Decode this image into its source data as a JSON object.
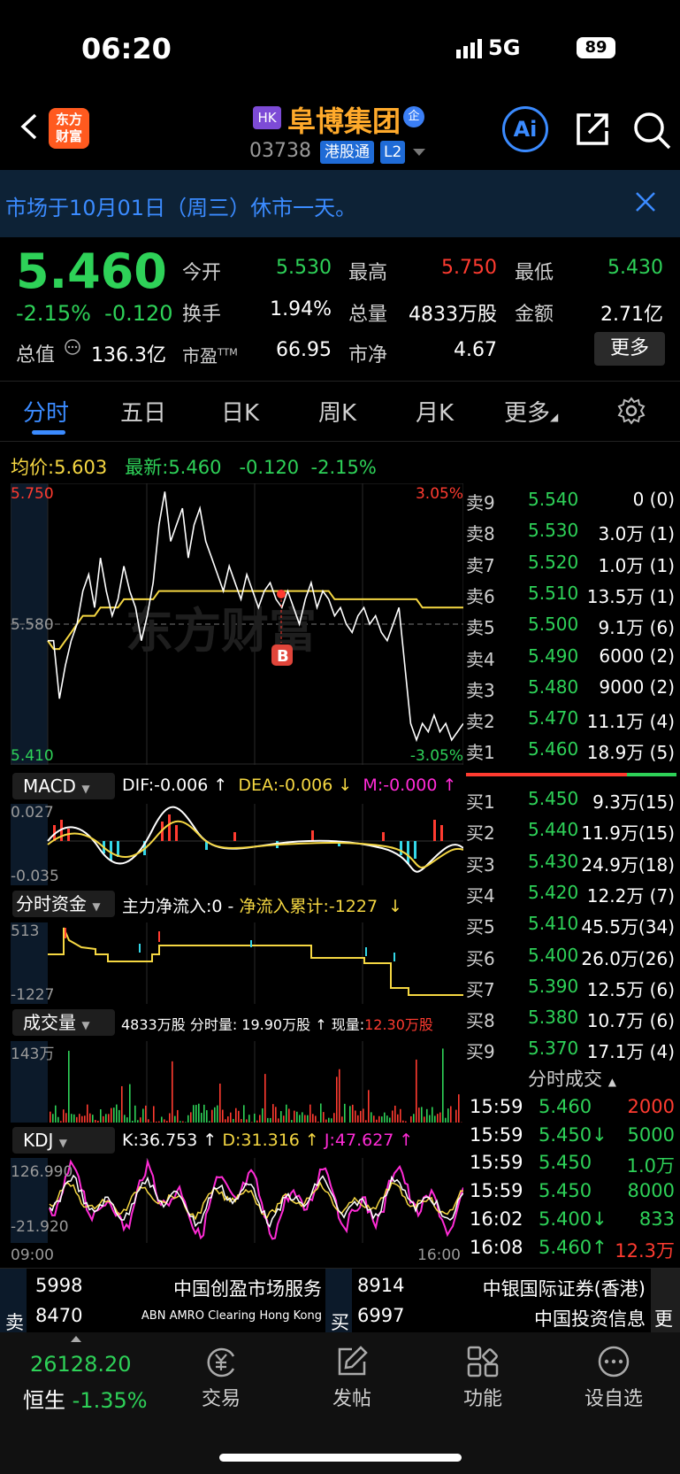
{
  "status": {
    "time": "06:20",
    "network": "5G",
    "battery": "89"
  },
  "header": {
    "market_badge": "HK",
    "name": "阜博集团",
    "qy_badge": "企",
    "code": "03738",
    "ggt": "港股通",
    "level": "L2",
    "logo": "东方\n财富",
    "ai": "Ai"
  },
  "notice": {
    "text": "市场于10月01日（周三）休市一天。"
  },
  "quote": {
    "price": "5.460",
    "change_pct": "-2.15%",
    "change": "-0.120",
    "open_label": "今开",
    "open": "5.530",
    "high_label": "最高",
    "high": "5.750",
    "low_label": "最低",
    "low": "5.430",
    "turnover_label": "换手",
    "turnover": "1.94%",
    "volume_label": "总量",
    "volume": "4833万股",
    "amount_label": "金额",
    "amount": "2.71亿",
    "mktcap_label": "总值",
    "mktcap": "136.3亿",
    "pe_label": "市盈",
    "pe_sup": "TTM",
    "pe": "66.95",
    "pb_label": "市净",
    "pb": "4.67",
    "more": "更多"
  },
  "tabs": [
    "分时",
    "五日",
    "日K",
    "周K",
    "月K",
    "更多"
  ],
  "infoline": {
    "avg_label": "均价:",
    "avg": "5.603",
    "last_label": "最新:",
    "last": "5.460",
    "chg": "-0.120",
    "pct": "-2.15%"
  },
  "chart_data": {
    "type": "line",
    "title": "",
    "price_axis": {
      "top": "5.750",
      "mid": "5.580",
      "bottom": "5.410",
      "top_pct": "3.05%",
      "bottom_pct": "-3.05%"
    },
    "time_axis": {
      "start": "09:00",
      "end": "16:00"
    },
    "marker": "B",
    "watermark": "东方财富",
    "ylim": [
      5.41,
      5.75
    ],
    "price": [
      5.56,
      5.56,
      5.49,
      5.53,
      5.56,
      5.58,
      5.62,
      5.64,
      5.6,
      5.66,
      5.62,
      5.59,
      5.61,
      5.65,
      5.62,
      5.6,
      5.56,
      5.59,
      5.63,
      5.7,
      5.74,
      5.68,
      5.7,
      5.72,
      5.66,
      5.7,
      5.72,
      5.68,
      5.66,
      5.64,
      5.62,
      5.65,
      5.63,
      5.61,
      5.64,
      5.62,
      5.6,
      5.62,
      5.63,
      5.61,
      5.6,
      5.62,
      5.6,
      5.58,
      5.61,
      5.63,
      5.6,
      5.62,
      5.61,
      5.59,
      5.6,
      5.58,
      5.57,
      5.59,
      5.6,
      5.58,
      5.59,
      5.57,
      5.56,
      5.58,
      5.6,
      5.53,
      5.46,
      5.44,
      5.46,
      5.45,
      5.47,
      5.45,
      5.46,
      5.44,
      5.45,
      5.46
    ],
    "avg": [
      5.56,
      5.55,
      5.55,
      5.56,
      5.57,
      5.58,
      5.59,
      5.59,
      5.59,
      5.6,
      5.6,
      5.6,
      5.6,
      5.61,
      5.61,
      5.61,
      5.61,
      5.61,
      5.61,
      5.62,
      5.62,
      5.62,
      5.62,
      5.62,
      5.62,
      5.62,
      5.62,
      5.62,
      5.62,
      5.62,
      5.62,
      5.62,
      5.62,
      5.62,
      5.62,
      5.62,
      5.62,
      5.62,
      5.62,
      5.62,
      5.62,
      5.62,
      5.62,
      5.62,
      5.62,
      5.62,
      5.62,
      5.62,
      5.62,
      5.61,
      5.61,
      5.61,
      5.61,
      5.61,
      5.61,
      5.61,
      5.61,
      5.61,
      5.61,
      5.61,
      5.61,
      5.61,
      5.61,
      5.61,
      5.6,
      5.6,
      5.6,
      5.6,
      5.6,
      5.6,
      5.6,
      5.6
    ]
  },
  "macd": {
    "label": "MACD",
    "dif": "DIF:-0.006 ↑",
    "dea": "DEA:-0.006 ↓",
    "m": "M:-0.000 ↑",
    "top": "0.027",
    "bottom": "-0.035"
  },
  "fund": {
    "label": "分时资金",
    "main": "主力净流入:0",
    "sep": " - ",
    "cum": "净流入累计:-1227",
    "arrow": "↓",
    "top": "513",
    "bottom": "-1227"
  },
  "vol": {
    "label": "成交量",
    "total": "4833万股",
    "fs": "分时量: 19.90万股 ↑",
    "now_label": "现量:",
    "now": "12.30万股",
    "top": "143万"
  },
  "kdj": {
    "label": "KDJ",
    "k": "K:36.753 ↑",
    "d": "D:31.316 ↑",
    "j": "J:47.627 ↑",
    "top": "126.990",
    "bottom": "-21.920"
  },
  "orderbook": {
    "asks": [
      {
        "l": "卖9",
        "p": "5.540",
        "v": "0 (0)"
      },
      {
        "l": "卖8",
        "p": "5.530",
        "v": "3.0万 (1)"
      },
      {
        "l": "卖7",
        "p": "5.520",
        "v": "1.0万 (1)"
      },
      {
        "l": "卖6",
        "p": "5.510",
        "v": "13.5万 (1)"
      },
      {
        "l": "卖5",
        "p": "5.500",
        "v": "9.1万 (6)"
      },
      {
        "l": "卖4",
        "p": "5.490",
        "v": "6000 (2)"
      },
      {
        "l": "卖3",
        "p": "5.480",
        "v": "9000 (2)"
      },
      {
        "l": "卖2",
        "p": "5.470",
        "v": "11.1万 (4)"
      },
      {
        "l": "卖1",
        "p": "5.460",
        "v": "18.9万 (5)"
      }
    ],
    "bids": [
      {
        "l": "买1",
        "p": "5.450",
        "v": "9.3万(15)"
      },
      {
        "l": "买2",
        "p": "5.440",
        "v": "11.9万(15)"
      },
      {
        "l": "买3",
        "p": "5.430",
        "v": "24.9万(18)"
      },
      {
        "l": "买4",
        "p": "5.420",
        "v": "12.2万 (7)"
      },
      {
        "l": "买5",
        "p": "5.410",
        "v": "45.5万(34)"
      },
      {
        "l": "买6",
        "p": "5.400",
        "v": "26.0万(26)"
      },
      {
        "l": "买7",
        "p": "5.390",
        "v": "12.5万 (6)"
      },
      {
        "l": "买8",
        "p": "5.380",
        "v": "10.7万 (6)"
      },
      {
        "l": "买9",
        "p": "5.370",
        "v": "17.1万 (4)"
      }
    ]
  },
  "trades": {
    "title": "分时成交",
    "rows": [
      {
        "t": "15:59",
        "p": "5.460",
        "v": "2000",
        "c": "#ff3b30"
      },
      {
        "t": "15:59",
        "p": "5.450↓",
        "v": "5000",
        "c": "#2ed158"
      },
      {
        "t": "15:59",
        "p": "5.450",
        "v": "1.0万",
        "c": "#2ed158"
      },
      {
        "t": "15:59",
        "p": "5.450",
        "v": "8000",
        "c": "#2ed158"
      },
      {
        "t": "16:02",
        "p": "5.400↓",
        "v": "833",
        "c": "#2ed158"
      },
      {
        "t": "16:08",
        "p": "5.460↑",
        "v": "12.3万",
        "c": "#ff3b30"
      }
    ]
  },
  "brokers": {
    "sell_label": "卖",
    "buy_label": "买",
    "more": "更",
    "sell": [
      {
        "code": "5998",
        "name": "中国创盈市场服务"
      },
      {
        "code": "8470",
        "name": "ABN AMRO Clearing Hong Kong"
      }
    ],
    "buy": [
      {
        "code": "8914",
        "name": "中银国际证券(香港)"
      },
      {
        "code": "6997",
        "name": "中国投资信息"
      }
    ]
  },
  "bottom": {
    "index_value": "26128.20",
    "index_name": "恒生",
    "index_pct": "-1.35%",
    "trade": "交易",
    "post": "发帖",
    "func": "功能",
    "watch": "设自选"
  }
}
